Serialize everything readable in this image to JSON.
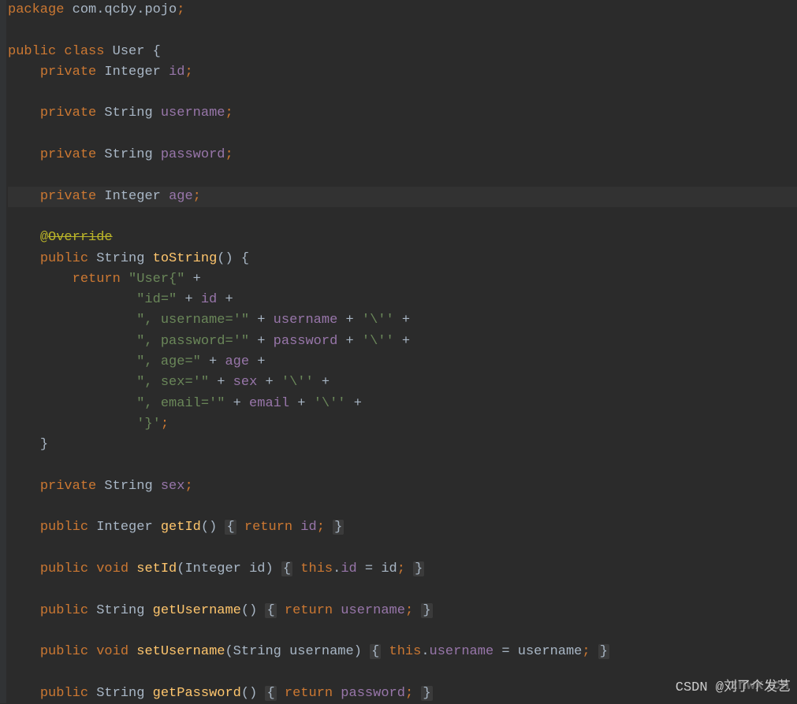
{
  "code": {
    "kw_package": "package",
    "pkg_name": " com.qcby.pojo",
    "semi": ";",
    "kw_public": "public",
    "kw_class": " class ",
    "class_name": "User ",
    "brace_open": "{",
    "brace_close": "}",
    "kw_private": "private",
    "type_integer": " Integer ",
    "type_string": " String ",
    "type_void": " void ",
    "field_id": "id",
    "field_username": "username",
    "field_password": "password",
    "field_age": "age",
    "field_sex": "sex",
    "annotation_override": "@Override",
    "method_toString": "toString",
    "parens": "()",
    "space_brace": " {",
    "kw_return": "return",
    "str_user_open": " \"User{\"",
    "plus": " +",
    "str_id_eq": "\"id=\"",
    "str_username_eq": "\", username='\"",
    "str_password_eq": "\", password='\"",
    "str_age_eq": "\", age=\"",
    "str_sex_eq": "\", sex='\"",
    "str_email_eq": "\", email='\"",
    "char_quote": "'\\''",
    "str_close_brace": "'}'",
    "method_getId": "getId",
    "method_setId": "setId",
    "method_getUsername": "getUsername",
    "method_setUsername": "setUsername",
    "method_getPassword": "getPassword",
    "param_integer_id": "(Integer id)",
    "param_string_username": "(String username)",
    "kw_this": "this",
    "dot": ".",
    "eq": " = ",
    "var_id": " id",
    "var_sex": " sex",
    "var_age": " age",
    "var_email": " email",
    "var_username": " username",
    "var_password": " password"
  },
  "watermarks": {
    "top": "znwx.cn",
    "bottom": "CSDN @刘了个发艺"
  }
}
